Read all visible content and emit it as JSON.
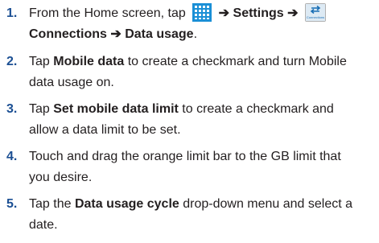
{
  "steps": [
    {
      "number": "1.",
      "line1_a": "From the Home screen, tap",
      "arrow1": "➔",
      "settings": "Settings",
      "arrow2": "➔",
      "connections_icon_label": "Connections",
      "line2_connections": "Connections",
      "arrow3": "➔",
      "data_usage": "Data usage",
      "period": "."
    },
    {
      "number": "2.",
      "line1_pre": "Tap ",
      "line1_bold": "Mobile data",
      "line1_post": " to create a checkmark and turn Mobile",
      "line2": "data usage on."
    },
    {
      "number": "3.",
      "line1_pre": "Tap ",
      "line1_bold": "Set mobile data limit",
      "line1_post": " to create a checkmark and",
      "line2": "allow a data limit to be set."
    },
    {
      "number": "4.",
      "line1": "Touch and drag the orange limit bar to the GB limit that",
      "line2": "you desire."
    },
    {
      "number": "5.",
      "line1_pre": "Tap the ",
      "line1_bold": "Data usage cycle",
      "line1_post": " drop-down menu and select a",
      "line2": "date."
    }
  ],
  "icons": {
    "apps": "apps-grid-icon",
    "connections": "connections-icon"
  },
  "colors": {
    "step_number": "#1b4f93",
    "apps_icon": "#1a8fd6",
    "connections_icon": "#1a6fb5"
  }
}
